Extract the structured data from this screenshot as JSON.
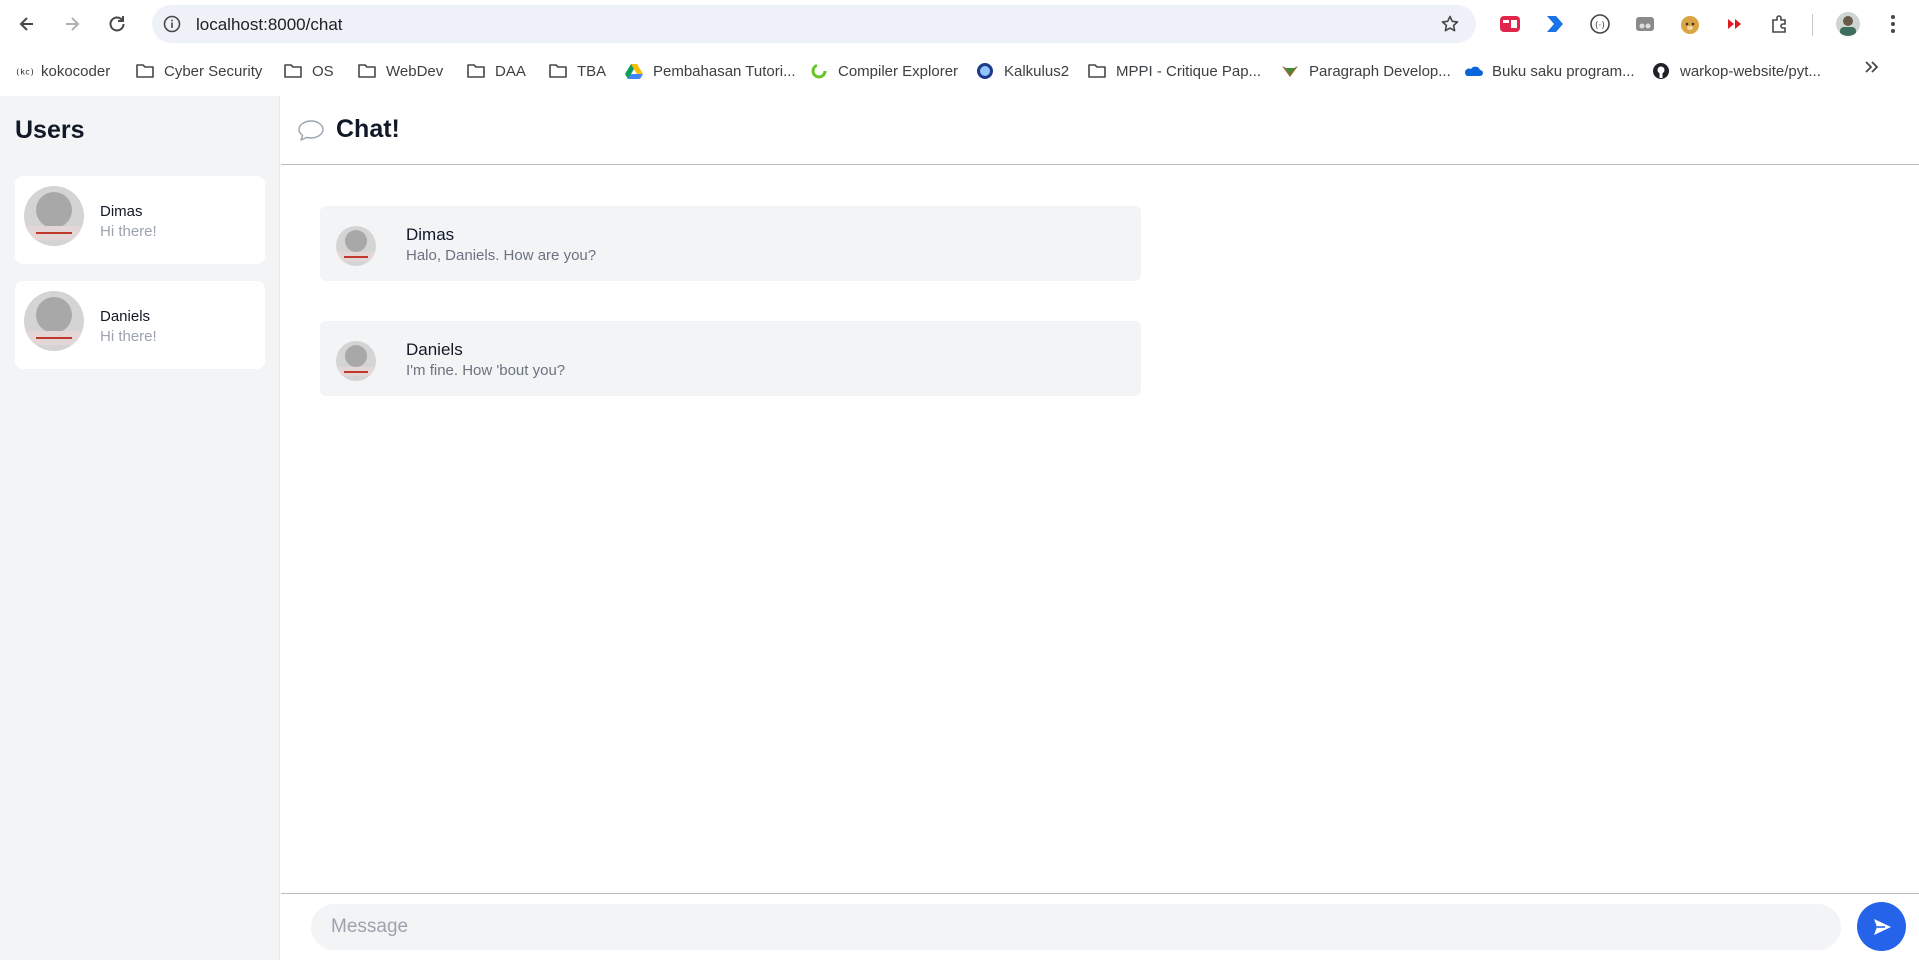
{
  "browser": {
    "url": "localhost:8000/chat",
    "bookmarks": [
      {
        "label": "kokocoder",
        "icon": "kokocoder-icon"
      },
      {
        "label": "Cyber Security",
        "icon": "folder-icon"
      },
      {
        "label": "OS",
        "icon": "folder-icon"
      },
      {
        "label": "WebDev",
        "icon": "folder-icon"
      },
      {
        "label": "DAA",
        "icon": "folder-icon"
      },
      {
        "label": "TBA",
        "icon": "folder-icon"
      },
      {
        "label": "Pembahasan Tutori...",
        "icon": "google-drive-icon"
      },
      {
        "label": "Compiler Explorer",
        "icon": "compiler-explorer-icon"
      },
      {
        "label": "Kalkulus2",
        "icon": "university-seal-icon"
      },
      {
        "label": "MPPI - Critique Pap...",
        "icon": "folder-icon"
      },
      {
        "label": "Paragraph Develop...",
        "icon": "paragraph-icon"
      },
      {
        "label": "Buku saku program...",
        "icon": "onedrive-icon"
      },
      {
        "label": "warkop-website/pyt...",
        "icon": "github-icon"
      }
    ]
  },
  "sidebar": {
    "title": "Users",
    "users": [
      {
        "name": "Dimas",
        "preview": "Hi there!"
      },
      {
        "name": "Daniels",
        "preview": "Hi there!"
      }
    ]
  },
  "chat": {
    "title": "Chat!",
    "messages": [
      {
        "sender": "Dimas",
        "text": "Halo, Daniels. How are you?"
      },
      {
        "sender": "Daniels",
        "text": "I'm fine. How 'bout you?"
      }
    ],
    "input_placeholder": "Message"
  },
  "colors": {
    "accent": "#2563eb",
    "sidebar_bg": "#f3f4f6",
    "bubble_bg": "#f3f4f6"
  }
}
